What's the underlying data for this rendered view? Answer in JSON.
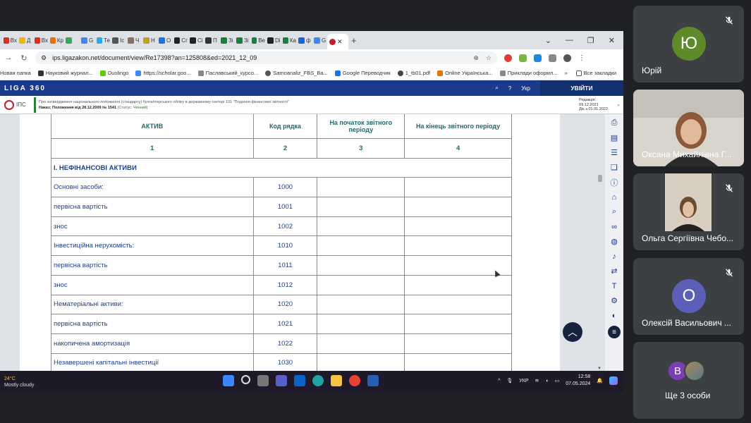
{
  "browser": {
    "url": "ips.ligazakon.net/document/view/Re17398?an=125808&ed=2021_12_09",
    "tab_labels": [
      "Вх",
      "Д",
      "Вх",
      "Кр",
      "",
      "G",
      "Те",
      "Іс",
      "Ч",
      "Н",
      "О",
      "Сг",
      "Сі",
      "П",
      "Зі",
      "Зі",
      "Ве",
      "Di",
      "Ка",
      "ф",
      "G",
      "ф"
    ],
    "bookmarks": [
      "Новая папка",
      "Науковий журнал...",
      "Duolingo",
      "https://scholar.goo...",
      "Паславський_курсо...",
      "Samoanaliz_FBS_Ва...",
      "Google Переводчик",
      "1_tb01.pdf",
      "Online Українська...",
      "Приклади оформл..."
    ],
    "bookmarks_all": "Все закладки"
  },
  "liga": {
    "logo": "LIGA 360",
    "lang": "Укр",
    "login": "УВІЙТИ",
    "ips_label": "ІПС",
    "doc_title": "Про затвердження національного положення (стандарту) бухгалтерського обліку в державному секторі 101 \"Подання фінансової звітності\"",
    "doc_meta": "Наказ; Положення від 28.12.2009 № 1541",
    "doc_status": "(Статус: Чинний)",
    "redak_label": "Редакція:",
    "redak_date": "09.12.2021",
    "redak_sub": "Діє з 01.01.2022"
  },
  "table": {
    "headers": [
      "АКТИВ",
      "Код рядка",
      "На початок звітного періоду",
      "На кінець звітного періоду"
    ],
    "numbers": [
      "1",
      "2",
      "3",
      "4"
    ],
    "section": "І. НЕФІНАНСОВІ АКТИВИ",
    "rows": [
      {
        "name": "Основні засоби:",
        "code": "1000"
      },
      {
        "name": "первісна вартість",
        "code": "1001"
      },
      {
        "name": "знос",
        "code": "1002"
      },
      {
        "name": "Інвестиційна нерухомість:",
        "code": "1010"
      },
      {
        "name": "первісна вартість",
        "code": "1011"
      },
      {
        "name": "знос",
        "code": "1012"
      },
      {
        "name": "Нематеріальні активи:",
        "code": "1020"
      },
      {
        "name": "первісна вартість",
        "code": "1021"
      },
      {
        "name": "накопичена амортизація",
        "code": "1022"
      },
      {
        "name": "Незавершені капітальні інвестиції",
        "code": "1030"
      }
    ]
  },
  "taskbar": {
    "temp": "24°C",
    "weather": "Mostly cloudy",
    "lang": "УКР",
    "time": "12:58",
    "date": "07.05.2024"
  },
  "participants": [
    {
      "name": "Юрій",
      "initial": "Ю",
      "color": "#5f8a2a",
      "muted": true,
      "video": false
    },
    {
      "name": "Оксана Михайлівна Г...",
      "initial": "",
      "color": "",
      "muted": false,
      "video": true
    },
    {
      "name": "Ольга Сергіївна Чебо...",
      "initial": "",
      "color": "",
      "muted": true,
      "video": true
    },
    {
      "name": "Олексій Васильович ...",
      "initial": "О",
      "color": "#5c5fb8",
      "muted": true,
      "video": false
    }
  ],
  "more": {
    "label": "Ще 3 особи",
    "initial": "В",
    "color": "#7b3fb5"
  }
}
